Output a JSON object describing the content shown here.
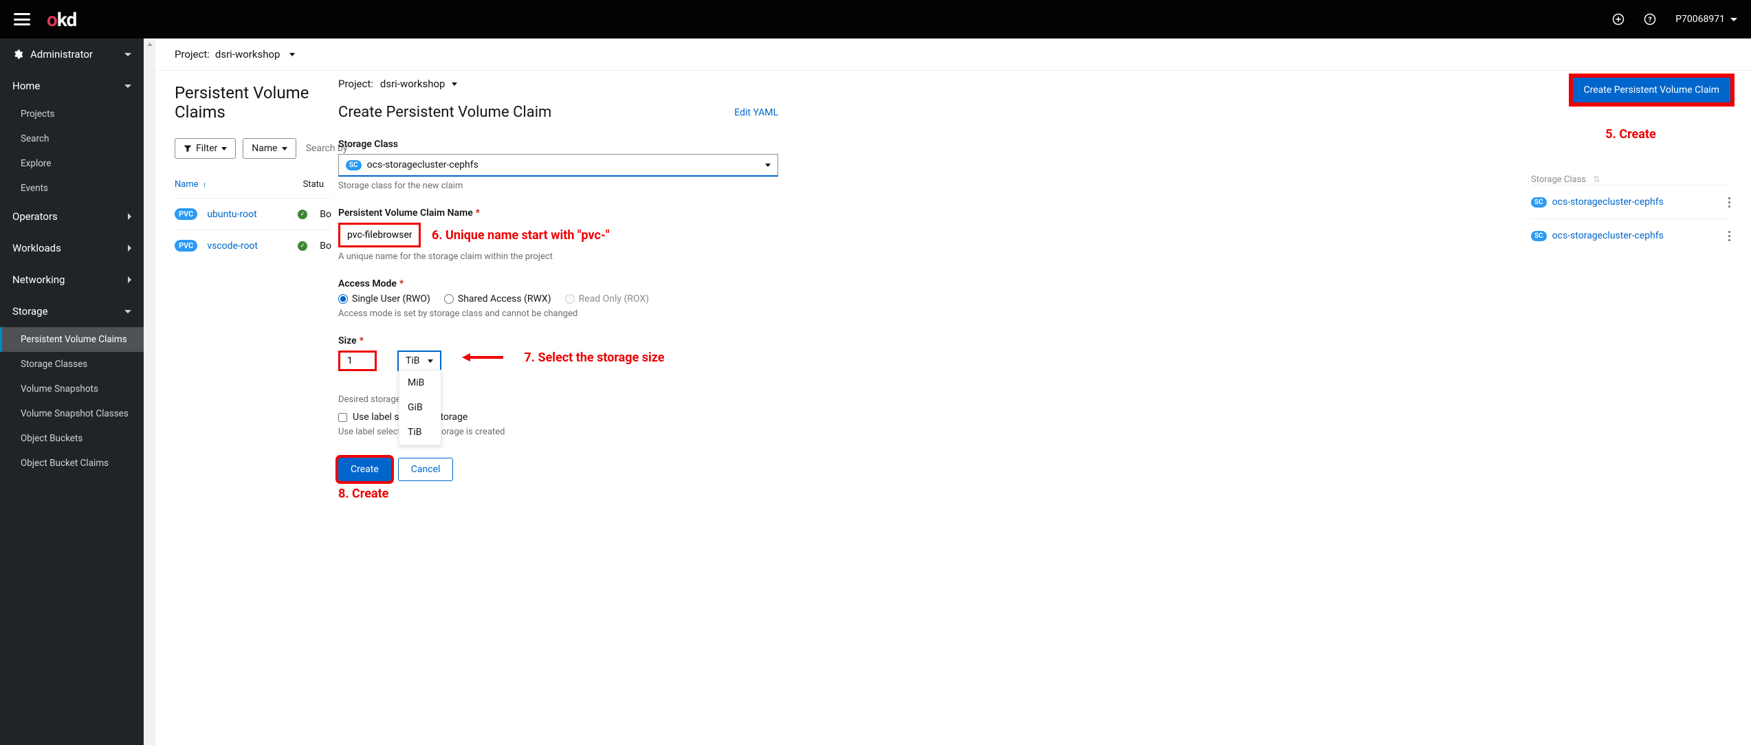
{
  "topbar": {
    "user": "P70068971"
  },
  "sidebar": {
    "perspective": "Administrator",
    "home": {
      "label": "Home",
      "items": [
        "Projects",
        "Search",
        "Explore",
        "Events"
      ]
    },
    "operators": "Operators",
    "workloads": "Workloads",
    "networking": "Networking",
    "storage": {
      "label": "Storage",
      "items": [
        "Persistent Volume Claims",
        "Storage Classes",
        "Volume Snapshots",
        "Volume Snapshot Classes",
        "Object Buckets",
        "Object Bucket Claims"
      ]
    }
  },
  "project_bar": {
    "prefix": "Project:",
    "name": "dsri-workshop"
  },
  "list": {
    "title": "Persistent Volume Claims",
    "filter_label": "Filter",
    "name_label": "Name",
    "search_placeholder": "Search by na",
    "col_name": "Name",
    "col_status": "Statu",
    "rows": [
      {
        "badge": "PVC",
        "name": "ubuntu-root",
        "status_prefix": "Bo"
      },
      {
        "badge": "PVC",
        "name": "vscode-root",
        "status_prefix": "Bo"
      }
    ]
  },
  "form": {
    "project_prefix": "Project:",
    "project_name": "dsri-workshop",
    "title": "Create Persistent Volume Claim",
    "edit_yaml": "Edit YAML",
    "storage_class": {
      "label": "Storage Class",
      "badge": "SC",
      "value": "ocs-storagecluster-cephfs",
      "help": "Storage class for the new claim"
    },
    "name_field": {
      "label": "Persistent Volume Claim Name",
      "value": "pvc-filebrowser",
      "help": "A unique name for the storage claim within the project"
    },
    "access_mode": {
      "label": "Access Mode",
      "rwo": "Single User (RWO)",
      "rwx": "Shared Access (RWX)",
      "rox": "Read Only (ROX)",
      "help": "Access mode is set by storage class and cannot be changed"
    },
    "size": {
      "label": "Size",
      "value": "1",
      "unit": "TiB",
      "options": [
        "MiB",
        "GiB",
        "TiB"
      ],
      "help1": "Desired storage",
      "checkbox_label": "Use label sel           quest storage",
      "help2": "Use label selecto               e how storage is created"
    },
    "create_btn": "Create",
    "cancel_btn": "Cancel"
  },
  "right": {
    "create_button": "Create Persistent Volume Claim",
    "col_label": "Storage Class",
    "rows": [
      {
        "badge": "SC",
        "name": "ocs-storagecluster-cephfs"
      },
      {
        "badge": "SC",
        "name": "ocs-storagecluster-cephfs"
      }
    ]
  },
  "annotations": {
    "a5": "5. Create",
    "a6": "6. Unique name start with \"pvc-\"",
    "a7": "7. Select the storage size",
    "a8": "8. Create"
  },
  "chart_data": null
}
